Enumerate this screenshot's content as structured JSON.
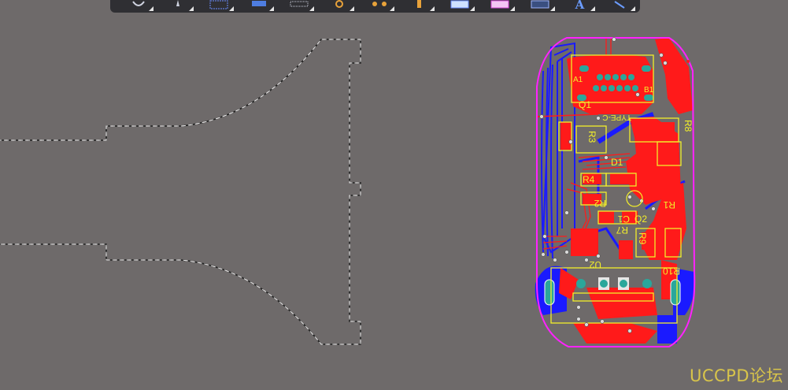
{
  "toolbar": {
    "buttons": [
      {
        "icon": "rotate-icon"
      },
      {
        "icon": "place-icon"
      },
      {
        "icon": "select-rectangle-icon"
      },
      {
        "icon": "component-icon"
      },
      {
        "icon": "pad-grid-icon"
      },
      {
        "icon": "via-icon"
      },
      {
        "icon": "route-icon"
      },
      {
        "icon": "fill-icon"
      },
      {
        "icon": "dimension-icon"
      },
      {
        "icon": "region-icon"
      },
      {
        "icon": "polygon-icon"
      },
      {
        "icon": "text-icon"
      },
      {
        "icon": "line-icon"
      }
    ],
    "text_button_label": "A"
  },
  "pcb": {
    "designators": {
      "a1": "A1",
      "b1": "B1",
      "q1": "Q1",
      "type_c": "TYPE-C",
      "r3": "R3",
      "r8": "R8",
      "d1": "D1",
      "r4": "R4",
      "r2": "R2",
      "r1": "R1",
      "c1": "C1",
      "q2": "Q2",
      "r7": "R7",
      "r9": "R9",
      "u2": "U2",
      "r10": "R10"
    },
    "colors": {
      "top_layer": "#ff1a1a",
      "bottom_layer": "#1a1aff",
      "silkscreen": "#f2ef2a",
      "board_outline": "#ff22ff",
      "pad": "#2aa79b",
      "background": "#6e6a6a"
    }
  },
  "watermark": "UCCPD论坛"
}
